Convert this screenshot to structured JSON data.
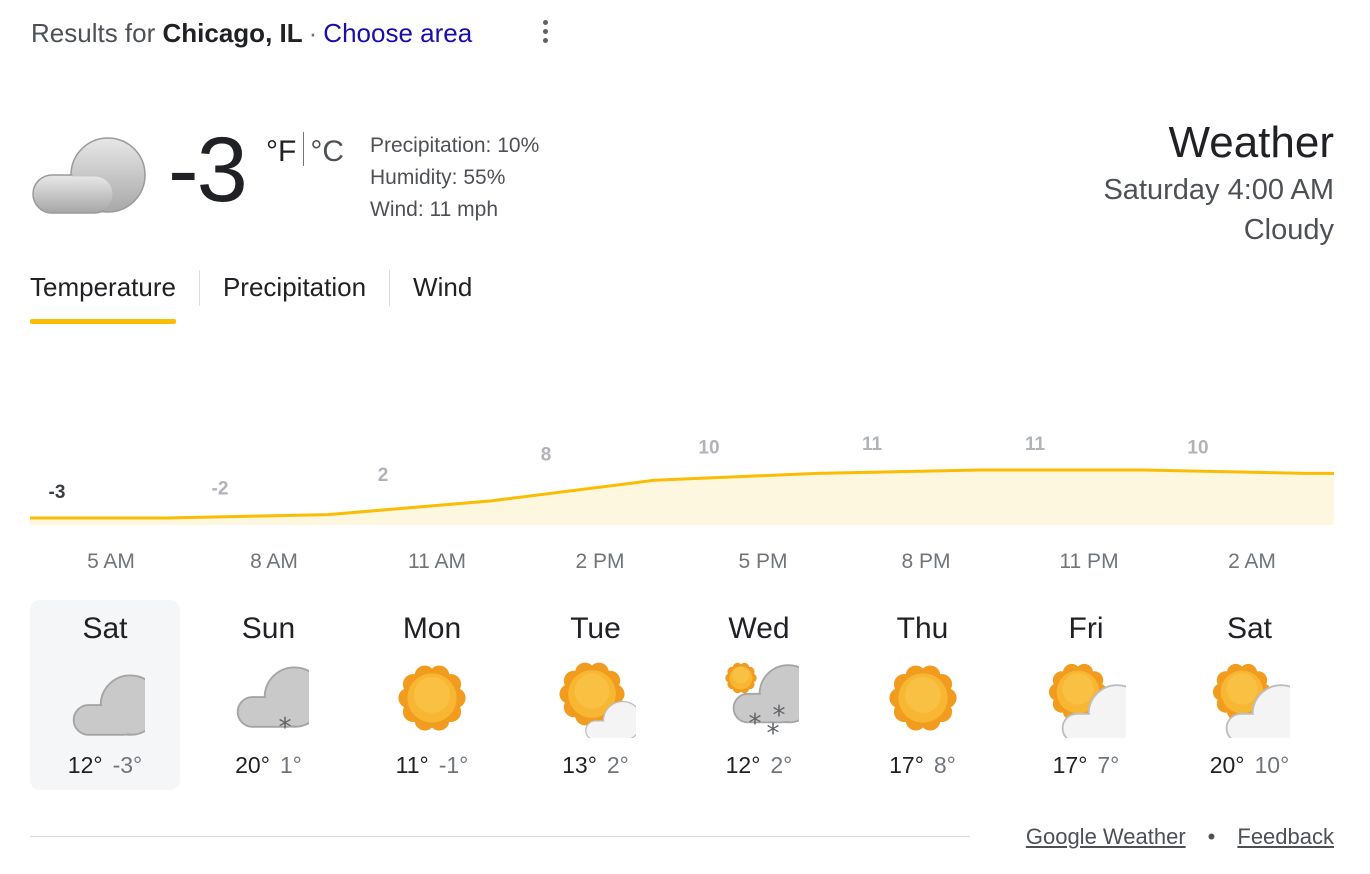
{
  "header": {
    "results_prefix": "Results for",
    "location": "Chicago, IL",
    "separator": "·",
    "choose_area": "Choose area"
  },
  "current": {
    "icon": "cloudy-icon",
    "temp": "-3",
    "unit_f": "°F",
    "unit_c": "°C",
    "precipitation": "Precipitation: 10%",
    "humidity": "Humidity: 55%",
    "wind": "Wind: 11 mph"
  },
  "side": {
    "title": "Weather",
    "datetime": "Saturday 4:00 AM",
    "condition": "Cloudy"
  },
  "tabs": [
    {
      "label": "Temperature",
      "active": true
    },
    {
      "label": "Precipitation",
      "active": false
    },
    {
      "label": "Wind",
      "active": false
    }
  ],
  "chart_data": {
    "type": "area",
    "x": [
      "5 AM",
      "8 AM",
      "11 AM",
      "2 PM",
      "5 PM",
      "8 PM",
      "11 PM",
      "2 AM"
    ],
    "values": [
      -3,
      -2,
      2,
      8,
      10,
      11,
      11,
      10
    ],
    "data_labels": [
      "-3",
      "-2",
      "2",
      "8",
      "10",
      "11",
      "11",
      "10"
    ],
    "series_color": "#fbbc04",
    "fill_color": "#fef7e0"
  },
  "days": [
    {
      "name": "Sat",
      "icon": "cloudy-icon",
      "hi": "12°",
      "lo": "-3°",
      "selected": true
    },
    {
      "name": "Sun",
      "icon": "cloudy-snow-icon",
      "hi": "20°",
      "lo": "1°",
      "selected": false
    },
    {
      "name": "Mon",
      "icon": "sunny-icon",
      "hi": "11°",
      "lo": "-1°",
      "selected": false
    },
    {
      "name": "Tue",
      "icon": "mostly-sunny-icon",
      "hi": "13°",
      "lo": "2°",
      "selected": false
    },
    {
      "name": "Wed",
      "icon": "snow-showers-icon",
      "hi": "12°",
      "lo": "2°",
      "selected": false
    },
    {
      "name": "Thu",
      "icon": "sunny-icon",
      "hi": "17°",
      "lo": "8°",
      "selected": false
    },
    {
      "name": "Fri",
      "icon": "partly-cloudy-icon",
      "hi": "17°",
      "lo": "7°",
      "selected": false
    },
    {
      "name": "Sat",
      "icon": "partly-cloudy-icon",
      "hi": "20°",
      "lo": "10°",
      "selected": false
    }
  ],
  "footer": {
    "google_weather": "Google Weather",
    "bullet": "•",
    "feedback": "Feedback"
  },
  "colors": {
    "link": "#1a0dab",
    "accent": "#fbbc04",
    "sun": "#f5a623",
    "cloud": "#c8c8c8"
  }
}
